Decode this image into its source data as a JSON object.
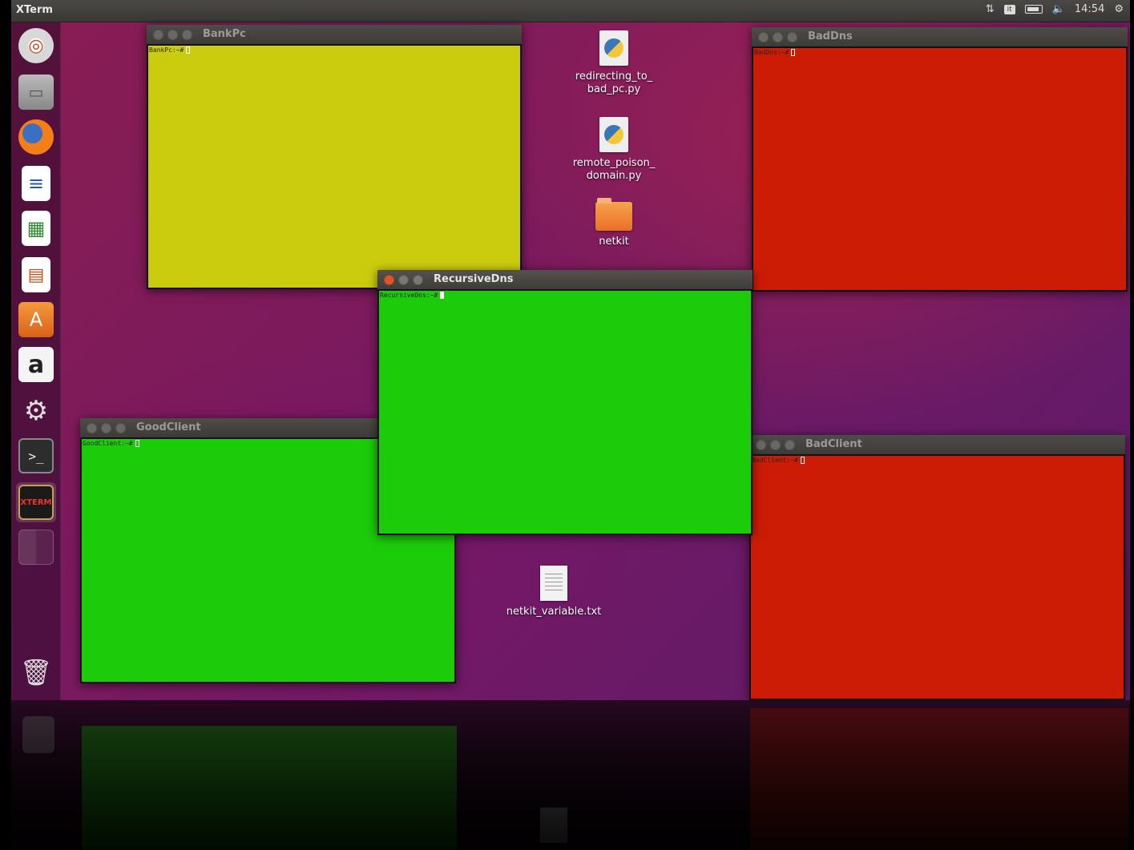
{
  "panel": {
    "app_title": "XTerm",
    "clock": "14:54",
    "keyboard_indicator": "it"
  },
  "launcher": {
    "items": [
      {
        "name": "dash-icon"
      },
      {
        "name": "files-icon"
      },
      {
        "name": "firefox-icon"
      },
      {
        "name": "writer-icon"
      },
      {
        "name": "calc-icon"
      },
      {
        "name": "impress-icon"
      },
      {
        "name": "software-center-icon"
      },
      {
        "name": "amazon-icon"
      },
      {
        "name": "system-settings-icon"
      },
      {
        "name": "terminal-icon"
      },
      {
        "name": "xterm-icon"
      },
      {
        "name": "workspace-switcher-icon"
      },
      {
        "name": "trash-icon"
      }
    ]
  },
  "windows": {
    "bankpc": {
      "title": "BankPc",
      "prompt": "BankPc:~#",
      "color": "#cccc0e"
    },
    "baddns": {
      "title": "BadDns",
      "prompt": "BadDns:~#",
      "color": "#cc1c05"
    },
    "recursivedns": {
      "title": "RecursiveDns",
      "prompt": "RecursiveDns:~#",
      "color": "#1ccc0a"
    },
    "goodclient": {
      "title": "GoodClient",
      "prompt": "GoodClient:~#",
      "color": "#1ccc0a"
    },
    "badclient": {
      "title": "BadClient",
      "prompt": "BadClient:~#",
      "color": "#cc1c05"
    }
  },
  "desktop": {
    "icons": [
      {
        "label": "redirecting_to_\nbad_pc.py"
      },
      {
        "label": "remote_poison_\ndomain.py"
      },
      {
        "label": "netkit"
      },
      {
        "label": "netkit_variable.txt"
      }
    ]
  }
}
